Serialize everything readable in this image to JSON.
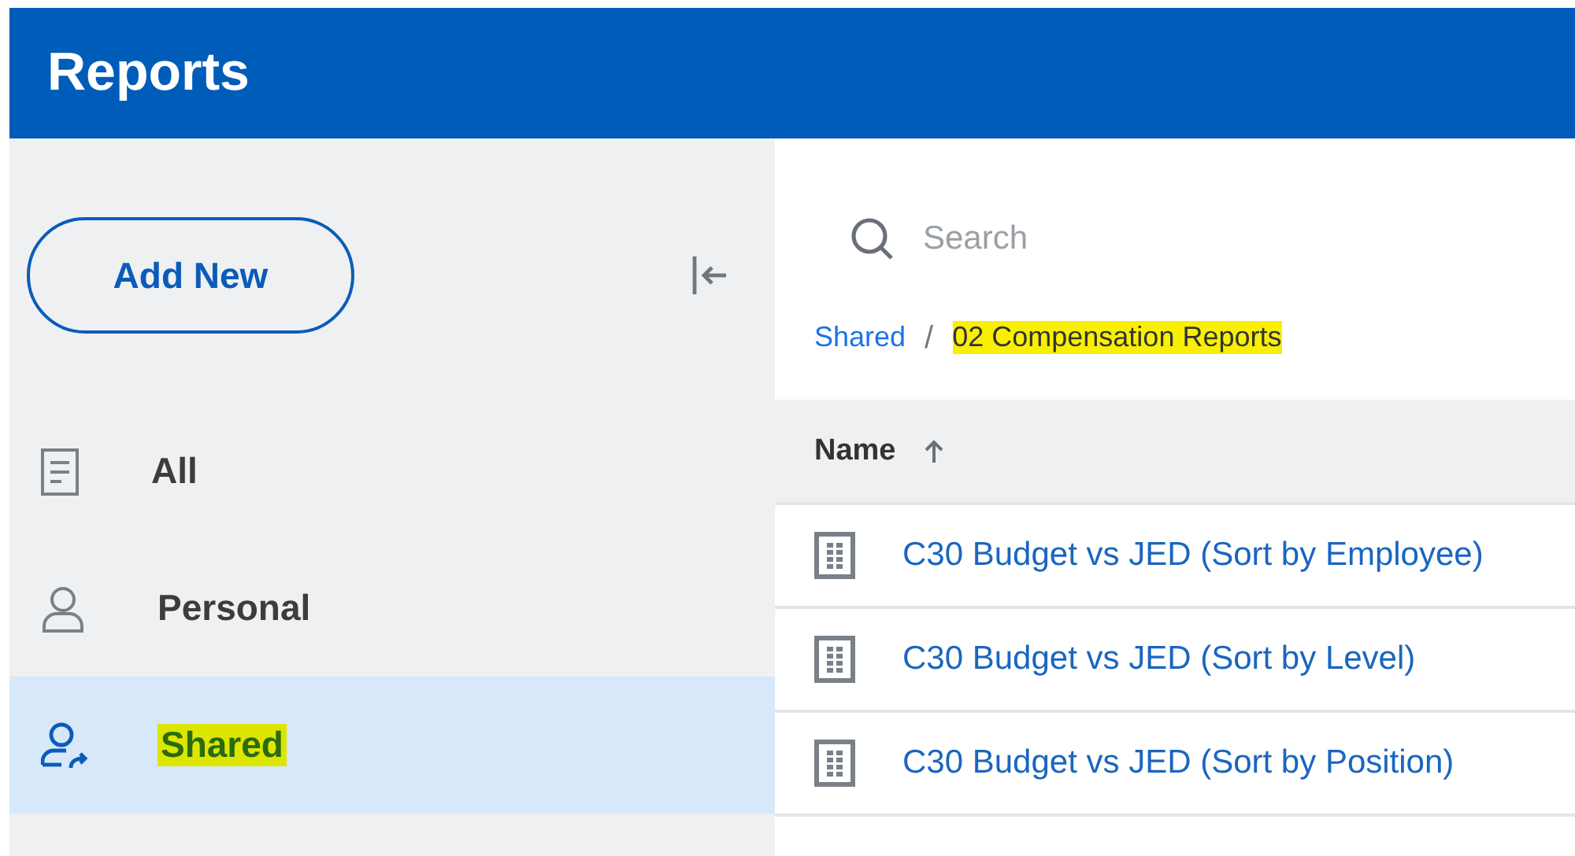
{
  "header": {
    "title": "Reports"
  },
  "sidebar": {
    "add_button": "Add New",
    "items": [
      {
        "label": "All",
        "kind": "document",
        "selected": false,
        "highlighted": false
      },
      {
        "label": "Personal",
        "kind": "person",
        "selected": false,
        "highlighted": false
      },
      {
        "label": "Shared",
        "kind": "shared",
        "selected": true,
        "highlighted": true
      }
    ]
  },
  "search": {
    "placeholder": "Search"
  },
  "breadcrumb_separator": "/",
  "breadcrumb": [
    {
      "label": "Shared",
      "highlighted": false
    },
    {
      "label": "02 Compensation Reports",
      "highlighted": true
    }
  ],
  "table": {
    "columns": [
      {
        "label": "Name",
        "sort_ascending": true
      }
    ],
    "rows": [
      {
        "name": "C30 Budget vs JED (Sort by Employee)"
      },
      {
        "name": "C30 Budget vs JED (Sort by Level)"
      },
      {
        "name": "C30 Budget vs JED (Sort by Position)"
      }
    ]
  }
}
